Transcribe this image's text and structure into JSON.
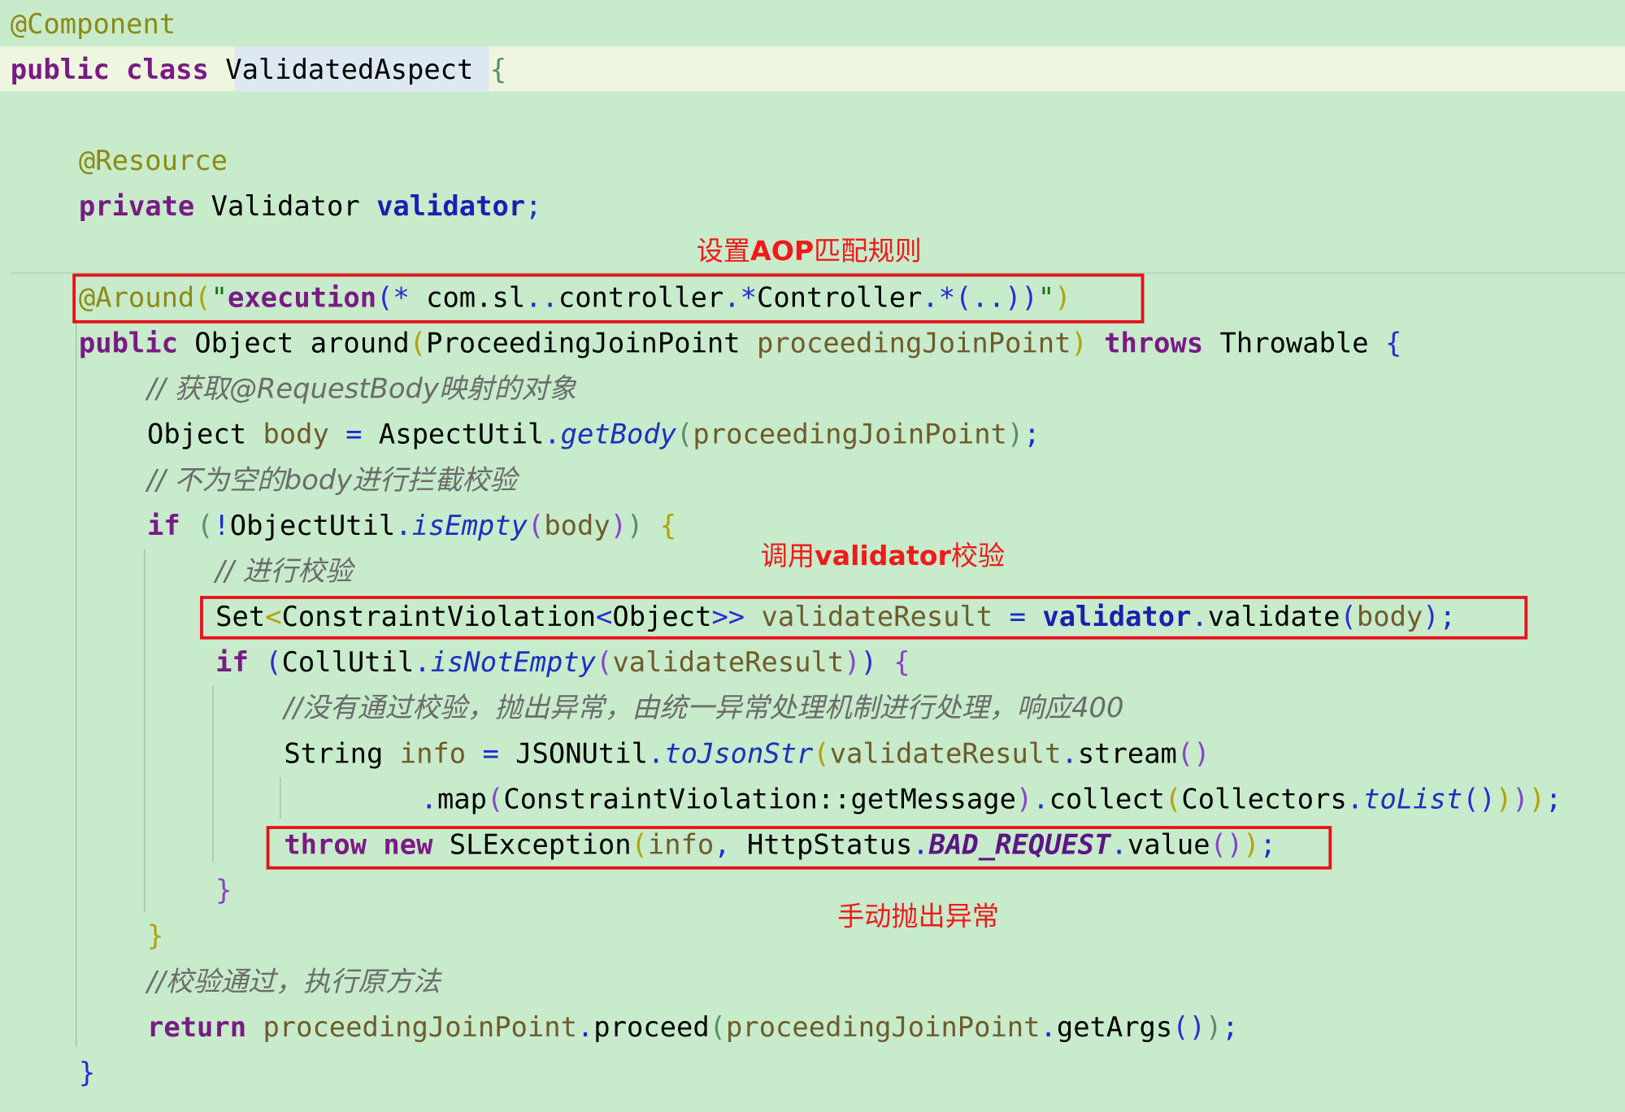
{
  "editor": {
    "background": "#c7ebcb",
    "caret_line_color": "#eef6df",
    "highlight_color": "#e8121b"
  },
  "code": {
    "l1": {
      "ann": "@Component"
    },
    "l2": {
      "kw1": "public",
      "kw2": "class",
      "name": "ValidatedAspect",
      "brace": "{"
    },
    "l3": {
      "ann": "@Resource"
    },
    "l4": {
      "kw": "private",
      "type": "Validator",
      "field": "validator",
      "semi": ";"
    },
    "l5": {
      "ann": "@Around",
      "p1": "(",
      "q1": "\"",
      "exec": "execution",
      "p2": "(",
      "star": "*",
      "pkg": " com.sl",
      "dots": "..",
      "ctrl": "controller",
      "dot1": ".",
      "star2": "*",
      "ctrl2": "Controller",
      "dot2": ".",
      "star3": "*",
      "p3": "(",
      "dd": "..",
      "p4": ")",
      "p5": ")",
      "q2": "\"",
      "p6": ")"
    },
    "l6": {
      "kw1": "public",
      "type": "Object",
      "method": "around",
      "p1": "(",
      "ptype": "ProceedingJoinPoint",
      "param": "proceedingJoinPoint",
      "p2": ")",
      "kw2": "throws",
      "exc": "Throwable",
      "brace": "{"
    },
    "l7": {
      "comment": "// 获取@RequestBody映射的对象"
    },
    "l8": {
      "type": "Object",
      "var": "body",
      "eq": "=",
      "cls": "AspectUtil",
      "dot": ".",
      "method": "getBody",
      "p1": "(",
      "arg": "proceedingJoinPoint",
      "p2": ")",
      "semi": ";"
    },
    "l9": {
      "comment": "// 不为空的body进行拦截校验"
    },
    "l10": {
      "kw": "if",
      "p1": "(",
      "not": "!",
      "cls": "ObjectUtil",
      "dot": ".",
      "method": "isEmpty",
      "p2": "(",
      "arg": "body",
      "p3": ")",
      "p4": ")",
      "brace": "{"
    },
    "l11": {
      "comment": "// 进行校验"
    },
    "l12": {
      "t1": "Set",
      "lt1": "<",
      "t2": "ConstraintViolation",
      "lt2": "<",
      "t3": "Object",
      "gt": ">>",
      "var": "validateResult",
      "eq": "=",
      "field": "validator",
      "dot": ".",
      "method": "validate",
      "p1": "(",
      "arg": "body",
      "p2": ")",
      "semi": ";"
    },
    "l13": {
      "kw": "if",
      "p1": "(",
      "cls": "CollUtil",
      "dot": ".",
      "method": "isNotEmpty",
      "p2": "(",
      "arg": "validateResult",
      "p3": ")",
      "p4": ")",
      "brace": "{"
    },
    "l14": {
      "comment": "//没有通过校验，抛出异常，由统一异常处理机制进行处理，响应400"
    },
    "l15": {
      "type": "String",
      "var": "info",
      "eq": "=",
      "cls": "JSONUtil",
      "dot": ".",
      "method": "toJsonStr",
      "p1": "(",
      "arg": "validateResult",
      "dot2": ".",
      "m2": "stream",
      "pp": "()"
    },
    "l16": {
      "dot": ".",
      "m1": "map",
      "p1": "(",
      "ref": "ConstraintViolation::getMessage",
      "p2": ")",
      "dot2": ".",
      "m2": "collect",
      "p3": "(",
      "cls": "Collectors",
      "dot3": ".",
      "m3": "toList",
      "pp": "()",
      "p4": ")",
      "p5": ")",
      "p6": ")",
      "semi": ";"
    },
    "l17": {
      "kw1": "throw",
      "kw2": "new",
      "cls": "SLException",
      "p1": "(",
      "arg": "info",
      "comma": ",",
      "cls2": "HttpStatus",
      "dot": ".",
      "const": "BAD_REQUEST",
      "dot2": ".",
      "m": "value",
      "pp": "()",
      "p2": ")",
      "semi": ";"
    },
    "l18": {
      "brace": "}"
    },
    "l19": {
      "brace": "}"
    },
    "l20": {
      "comment": "//校验通过，执行原方法"
    },
    "l21": {
      "kw": "return",
      "var": "proceedingJoinPoint",
      "dot": ".",
      "m": "proceed",
      "p1": "(",
      "arg": "proceedingJoinPoint",
      "dot2": ".",
      "m2": "getArgs",
      "pp": "()",
      "p2": ")",
      "semi": ";"
    },
    "l22": {
      "brace": "}"
    }
  },
  "annotations": {
    "aop_rule": {
      "pre": "设置",
      "bold": "AOP",
      "post": "匹配规则"
    },
    "call_validator": {
      "pre": "调用",
      "bold": "validator",
      "post": "校验"
    },
    "throw_manual": "手动抛出异常"
  }
}
